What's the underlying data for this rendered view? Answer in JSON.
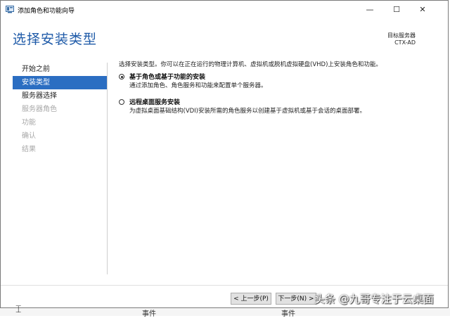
{
  "window": {
    "title": "添加角色和功能向导",
    "minimize_glyph": "—",
    "maximize_glyph": "☐",
    "close_glyph": "✕"
  },
  "header": {
    "title": "选择安装类型",
    "dest_label": "目标服务器",
    "dest_value": "CTX-AD"
  },
  "nav": {
    "items": [
      {
        "label": "开始之前",
        "state": "normal"
      },
      {
        "label": "安装类型",
        "state": "active"
      },
      {
        "label": "服务器选择",
        "state": "normal"
      },
      {
        "label": "服务器角色",
        "state": "disabled"
      },
      {
        "label": "功能",
        "state": "disabled"
      },
      {
        "label": "确认",
        "state": "disabled"
      },
      {
        "label": "结果",
        "state": "disabled"
      }
    ]
  },
  "content": {
    "intro": "选择安装类型。你可以在正在运行的物理计算机、虚拟机或脱机虚拟硬盘(VHD)上安装角色和功能。",
    "options": [
      {
        "title": "基于角色或基于功能的安装",
        "desc": "通过添加角色、角色服务和功能来配置单个服务器。",
        "checked": true
      },
      {
        "title": "远程桌面服务安装",
        "desc": "为虚拟桌面基础结构(VDI)安装所需的角色服务以创建基于虚拟机或基于会话的桌面部署。",
        "checked": false
      }
    ]
  },
  "footer": {
    "prev_label": "< 上一步(P)",
    "next_label": "下一步(N) >"
  },
  "background": {
    "text1": "事件",
    "text2": "事件"
  },
  "watermark": "头条 @九哥专注于云桌面"
}
